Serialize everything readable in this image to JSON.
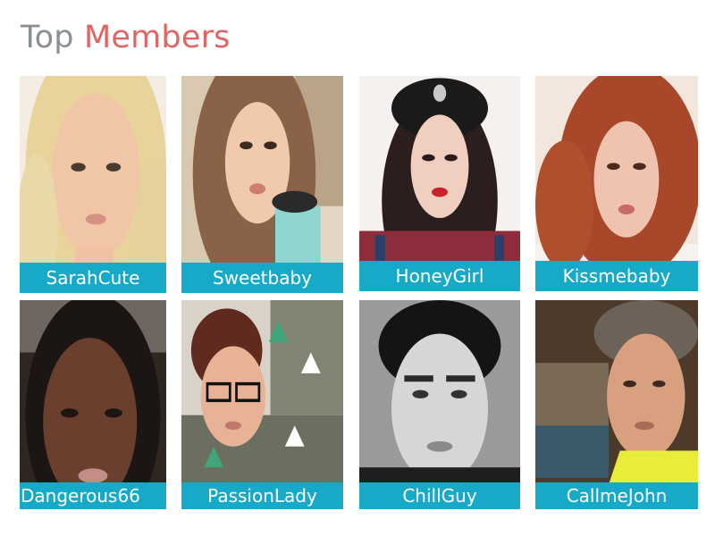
{
  "heading": {
    "word1": "Top",
    "word2": "Members"
  },
  "colors": {
    "label_bg": "#17a9c8",
    "heading_gray": "#8a8f94",
    "heading_accent": "#e06464"
  },
  "members": [
    {
      "name": "SarahCute"
    },
    {
      "name": "Sweetbaby"
    },
    {
      "name": "HoneyGirl"
    },
    {
      "name": "Kissmebaby"
    },
    {
      "name": "Dangerous66"
    },
    {
      "name": "PassionLady"
    },
    {
      "name": "ChillGuy"
    },
    {
      "name": "CallmeJohn"
    }
  ]
}
